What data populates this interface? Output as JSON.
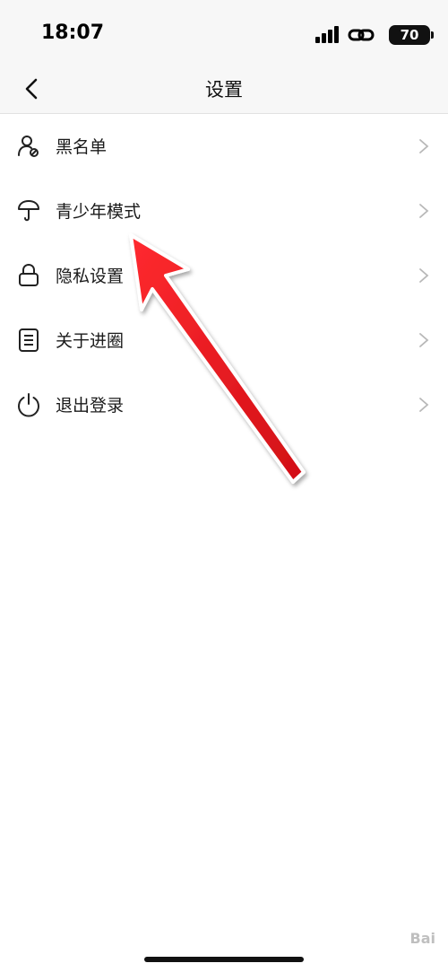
{
  "status_bar": {
    "time": "18:07",
    "battery": "70",
    "icons": [
      "signal-icon",
      "link-icon",
      "battery-icon"
    ]
  },
  "nav": {
    "title": "设置",
    "back_icon": "chevron-left-icon"
  },
  "menu": {
    "items": [
      {
        "label": "黑名单",
        "icon": "user-block-icon"
      },
      {
        "label": "青少年模式",
        "icon": "umbrella-icon"
      },
      {
        "label": "隐私设置",
        "icon": "lock-icon"
      },
      {
        "label": "关于进圈",
        "icon": "document-icon"
      },
      {
        "label": "退出登录",
        "icon": "power-icon"
      }
    ]
  },
  "annotation": {
    "type": "arrow",
    "color": "#e8141b",
    "points_to": "青少年模式"
  },
  "watermark": "Bai"
}
